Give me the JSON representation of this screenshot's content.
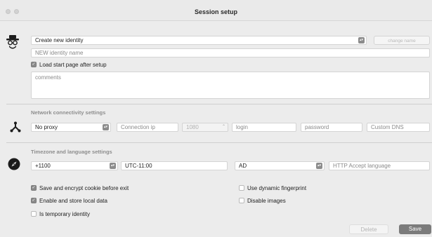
{
  "window": {
    "title": "Session setup"
  },
  "identity": {
    "select_value": "Create new identity",
    "change_name_label": "change name",
    "name_placeholder": "NEW identity name",
    "load_start_page_label": "Load start page after setup",
    "load_start_page_checked": true,
    "comments_placeholder": "comments"
  },
  "network": {
    "section_label": "Network connectivity settings",
    "proxy_value": "No proxy",
    "ip_placeholder": "Connection ip",
    "port_placeholder": "1080",
    "login_placeholder": "login",
    "password_placeholder": "password",
    "dns_placeholder": "Custom DNS"
  },
  "timezone": {
    "section_label": "Timezone and language settings",
    "offset_value": "+1100",
    "tz_value": "UTC-11:00",
    "language_value": "AD",
    "accept_language_placeholder": "HTTP Accept language"
  },
  "options": {
    "save_cookie_label": "Save and encrypt cookie before exit",
    "save_cookie_checked": true,
    "local_data_label": "Enable and store local data",
    "local_data_checked": true,
    "temporary_label": "Is temporary identity",
    "temporary_checked": false,
    "dynamic_fp_label": "Use dynamic fingerprint",
    "dynamic_fp_checked": false,
    "disable_images_label": "Disable images",
    "disable_images_checked": false
  },
  "footer": {
    "delete_label": "Delete",
    "save_label": "Save"
  },
  "colors": {
    "accent_dark": "#7b7b7b",
    "field_bg": "#ffffff",
    "window_bg": "#ececec"
  },
  "icons": {
    "identity": "spy-hat-glasses-icon",
    "network": "network-nodes-icon",
    "timezone": "compass-icon",
    "select": "stepper-arrows-icon",
    "check": "checkmark-icon"
  }
}
